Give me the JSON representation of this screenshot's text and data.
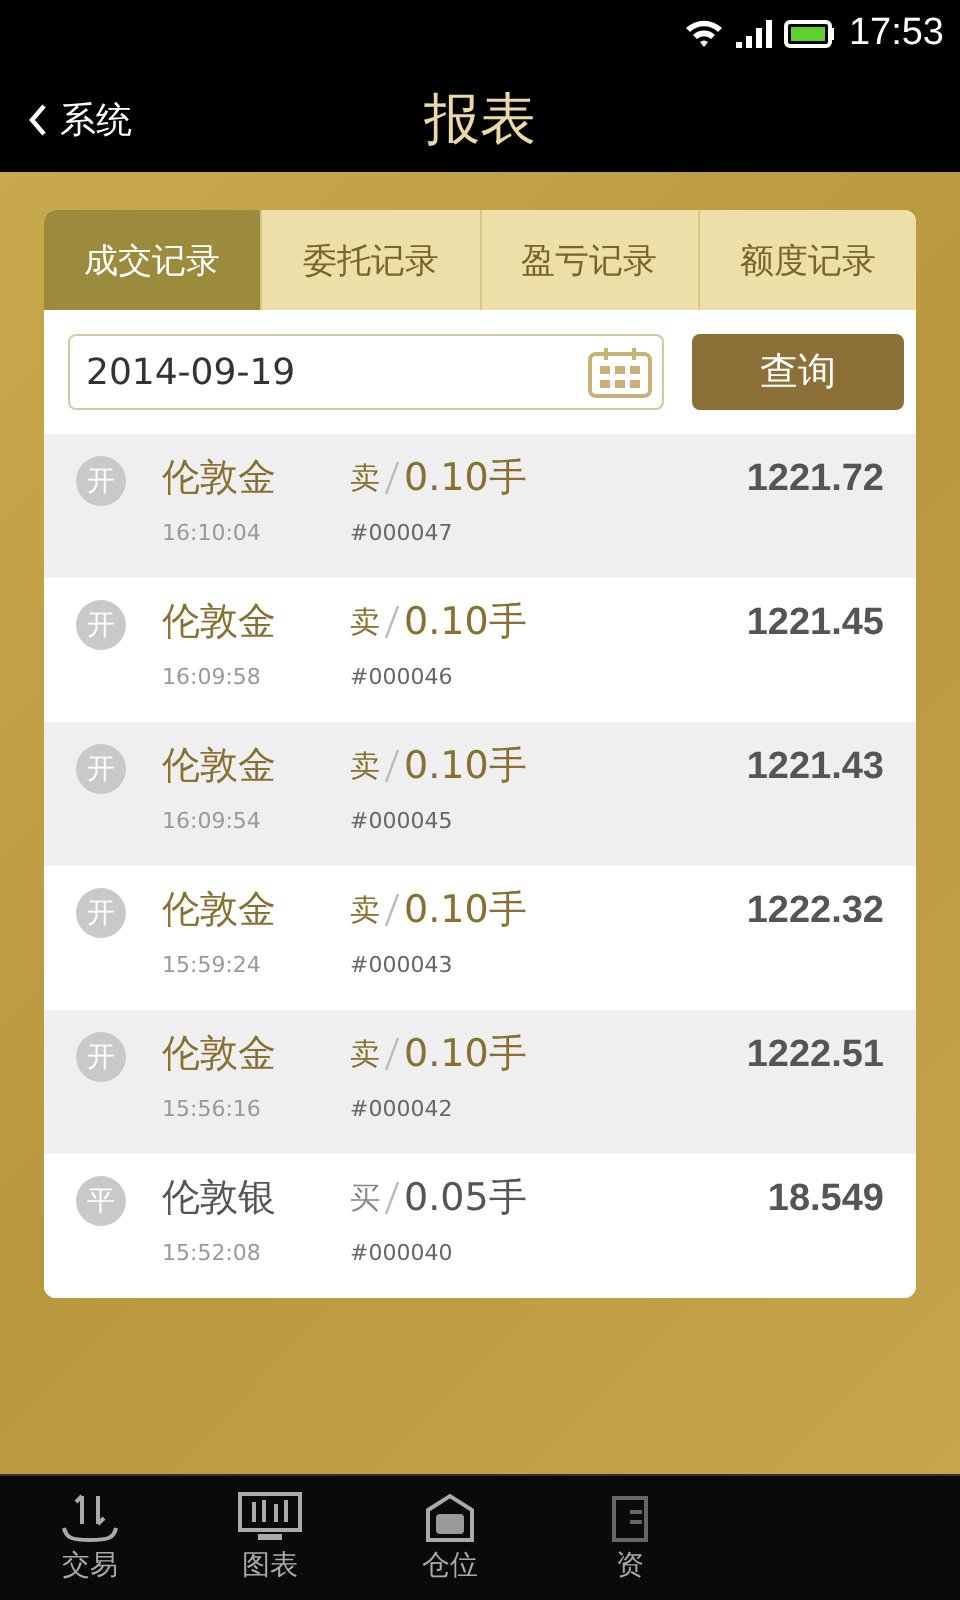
{
  "status_bar": {
    "time": "17:53"
  },
  "header": {
    "back": "系统",
    "title": "报表"
  },
  "tabs": [
    {
      "label": "成交记录",
      "selected": true
    },
    {
      "label": "委托记录",
      "selected": false
    },
    {
      "label": "盈亏记录",
      "selected": false
    },
    {
      "label": "额度记录",
      "selected": false
    }
  ],
  "query": {
    "date": "2014-09-19",
    "button": "查询"
  },
  "trades": [
    {
      "kind": "open",
      "badge": "开",
      "name": "伦敦金",
      "time": "16:10:04",
      "side": "卖",
      "amount": "0.10手",
      "order": "#000047",
      "price": "1221.72"
    },
    {
      "kind": "open",
      "badge": "开",
      "name": "伦敦金",
      "time": "16:09:58",
      "side": "卖",
      "amount": "0.10手",
      "order": "#000046",
      "price": "1221.45"
    },
    {
      "kind": "open",
      "badge": "开",
      "name": "伦敦金",
      "time": "16:09:54",
      "side": "卖",
      "amount": "0.10手",
      "order": "#000045",
      "price": "1221.43"
    },
    {
      "kind": "open",
      "badge": "开",
      "name": "伦敦金",
      "time": "15:59:24",
      "side": "卖",
      "amount": "0.10手",
      "order": "#000043",
      "price": "1222.32"
    },
    {
      "kind": "open",
      "badge": "开",
      "name": "伦敦金",
      "time": "15:56:16",
      "side": "卖",
      "amount": "0.10手",
      "order": "#000042",
      "price": "1222.51"
    },
    {
      "kind": "close",
      "badge": "平",
      "name": "伦敦银",
      "time": "15:52:08",
      "side": "买",
      "amount": "0.05手",
      "order": "#000040",
      "price": "18.549"
    }
  ],
  "nav": [
    {
      "kind": "trade",
      "label": "交易"
    },
    {
      "kind": "chart",
      "label": "图表"
    },
    {
      "kind": "position",
      "label": "仓位"
    },
    {
      "kind": "funds",
      "label": "资"
    }
  ]
}
